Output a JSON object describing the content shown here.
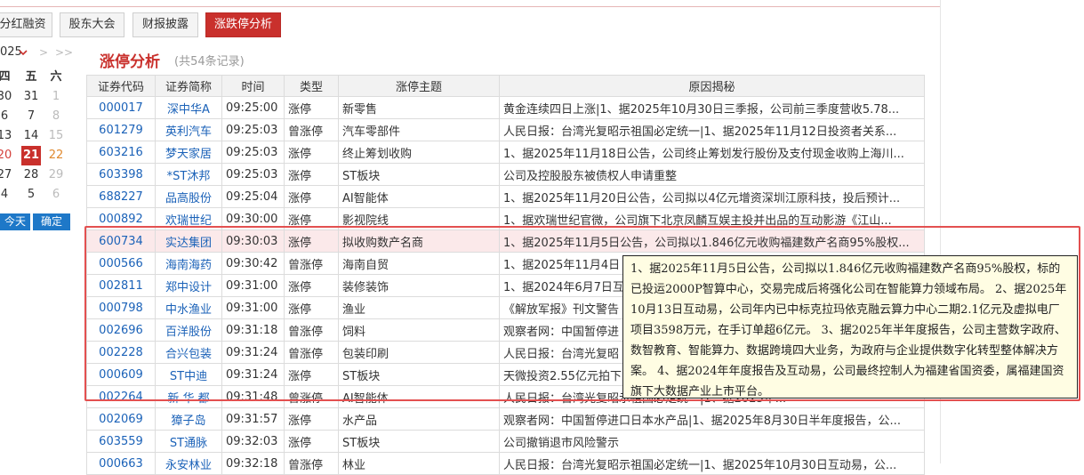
{
  "tabs": [
    {
      "label": "分红融资",
      "active": false
    },
    {
      "label": "股东大会",
      "active": false
    },
    {
      "label": "财报披露",
      "active": false
    },
    {
      "label": "涨跌停分析",
      "active": true
    }
  ],
  "calendar": {
    "year": "025",
    "nav_prev": ">",
    "nav_next": ">>",
    "weekdays": [
      "四",
      "五",
      "六"
    ],
    "rows": [
      [
        {
          "d": "30",
          "s": ""
        },
        {
          "d": "31",
          "s": ""
        },
        {
          "d": "1",
          "s": "grey"
        }
      ],
      [
        {
          "d": "6",
          "s": ""
        },
        {
          "d": "7",
          "s": ""
        },
        {
          "d": "8",
          "s": "grey"
        }
      ],
      [
        {
          "d": "13",
          "s": ""
        },
        {
          "d": "14",
          "s": ""
        },
        {
          "d": "15",
          "s": "grey"
        }
      ],
      [
        {
          "d": "20",
          "s": "red"
        },
        {
          "d": "21",
          "s": "sel"
        },
        {
          "d": "22",
          "s": "wkend"
        }
      ],
      [
        {
          "d": "27",
          "s": ""
        },
        {
          "d": "28",
          "s": ""
        },
        {
          "d": "29",
          "s": "grey"
        }
      ],
      [
        {
          "d": "4",
          "s": ""
        },
        {
          "d": "5",
          "s": ""
        },
        {
          "d": "6",
          "s": "grey"
        }
      ]
    ],
    "today_label": "今天",
    "confirm_label": "确定"
  },
  "page": {
    "title": "涨停分析",
    "count_label": "(共54条记录)"
  },
  "table": {
    "headers": [
      "证券代码",
      "证券简称",
      "时间",
      "类型",
      "涨停主题",
      "原因揭秘"
    ],
    "rows": [
      {
        "code": "000017",
        "name": "深中华A",
        "time": "09:25:00",
        "type": "涨停",
        "theme": "新零售",
        "reason": "黄金连续四日上涨|1、据2025年10月30日三季报，公司前三季度营收5.78..."
      },
      {
        "code": "601279",
        "name": "英利汽车",
        "time": "09:25:03",
        "type": "曾涨停",
        "theme": "汽车零部件",
        "reason": "人民日报：台湾光复昭示祖国必定统一|1、据2025年11月12日投资者关系..."
      },
      {
        "code": "603216",
        "name": "梦天家居",
        "time": "09:25:03",
        "type": "涨停",
        "theme": "终止筹划收购",
        "reason": "1、据2025年11月18日公告，公司终止筹划发行股份及支付现金收购上海川..."
      },
      {
        "code": "603398",
        "name": "*ST沐邦",
        "time": "09:25:03",
        "type": "涨停",
        "theme": "ST板块",
        "reason": "公司及控股股东被债权人申请重整"
      },
      {
        "code": "688227",
        "name": "品高股份",
        "time": "09:25:04",
        "type": "涨停",
        "theme": "AI智能体",
        "reason": "1、据2025年11月20日公告，公司拟以4亿元增资深圳江原科技，投后预计..."
      },
      {
        "code": "000892",
        "name": "欢瑞世纪",
        "time": "09:30:00",
        "type": "涨停",
        "theme": "影视院线",
        "reason": "1、据欢瑞世纪官微，公司旗下北京凤麟互娱主投并出品的互动影游《江山..."
      },
      {
        "code": "600734",
        "name": "实达集团",
        "time": "09:30:03",
        "type": "涨停",
        "theme": "拟收购数产名商",
        "reason": "1、据2025年11月5日公告，公司拟以1.846亿元收购福建数产名商95%股权..."
      },
      {
        "code": "000566",
        "name": "海南海药",
        "time": "09:30:42",
        "type": "曾涨停",
        "theme": "海南自贸",
        "reason": "1、据2025年11月4日"
      },
      {
        "code": "002811",
        "name": "郑中设计",
        "time": "09:31:00",
        "type": "涨停",
        "theme": "装修装饰",
        "reason": "1、据2024年6月7日互"
      },
      {
        "code": "000798",
        "name": "中水渔业",
        "time": "09:31:00",
        "type": "涨停",
        "theme": "渔业",
        "reason": "《解放军报》刊文警告"
      },
      {
        "code": "002696",
        "name": "百洋股份",
        "time": "09:31:18",
        "type": "曾涨停",
        "theme": "饲料",
        "reason": "观察者网：中国暂停进"
      },
      {
        "code": "002228",
        "name": "合兴包装",
        "time": "09:31:24",
        "type": "曾涨停",
        "theme": "包装印刷",
        "reason": "人民日报：台湾光复昭"
      },
      {
        "code": "000609",
        "name": "ST中迪",
        "time": "09:31:24",
        "type": "涨停",
        "theme": "ST板块",
        "reason": "天微投资2.55亿元拍下"
      },
      {
        "code": "002264",
        "name": "新 华 都",
        "time": "09:31:48",
        "type": "曾涨停",
        "theme": "AI智能体",
        "reason": "人民日报：台湾光复昭示祖国必定统一|1、据2025年..."
      },
      {
        "code": "002069",
        "name": "獐子岛",
        "time": "09:31:57",
        "type": "涨停",
        "theme": "水产品",
        "reason": "观察者网：中国暂停进口日本水产品|1、据2025年8月30日半年度报告，公..."
      },
      {
        "code": "603559",
        "name": "ST通脉",
        "time": "09:32:03",
        "type": "涨停",
        "theme": "ST板块",
        "reason": "公司撤销退市风险警示"
      },
      {
        "code": "000663",
        "name": "永安林业",
        "time": "09:32:18",
        "type": "曾涨停",
        "theme": "林业",
        "reason": "人民日报：台湾光复昭示祖国必定统一|1、据2025年10月30日互动易，公..."
      }
    ]
  },
  "tooltip": {
    "text": "1、据2025年11月5日公告，公司拟以1.846亿元收购福建数产名商95%股权，标的已投运2000P智算中心，交易完成后将强化公司在智能算力领域布局。 2、据2025年10月13日互动易，公司年内已中标克拉玛依克融云算力中心二期2.1亿元及虚拟电厂项目3598万元，在手订单超6亿元。 3、据2025年半年度报告，公司主营数字政府、数智教育、智能算力、数据跨境四大业务，为政府与企业提供数字化转型整体解决方案。 4、据2024年年度报告及互动易，公司最终控制人为福建省国资委，属福建国资旗下大数据产业上市平台。"
  },
  "colors": {
    "accent": "#c9302c",
    "link": "#1b62b8",
    "highlight_row": "#fbe9ea",
    "tooltip_bg": "#fffde3",
    "calendar_button": "#1e78c8"
  }
}
